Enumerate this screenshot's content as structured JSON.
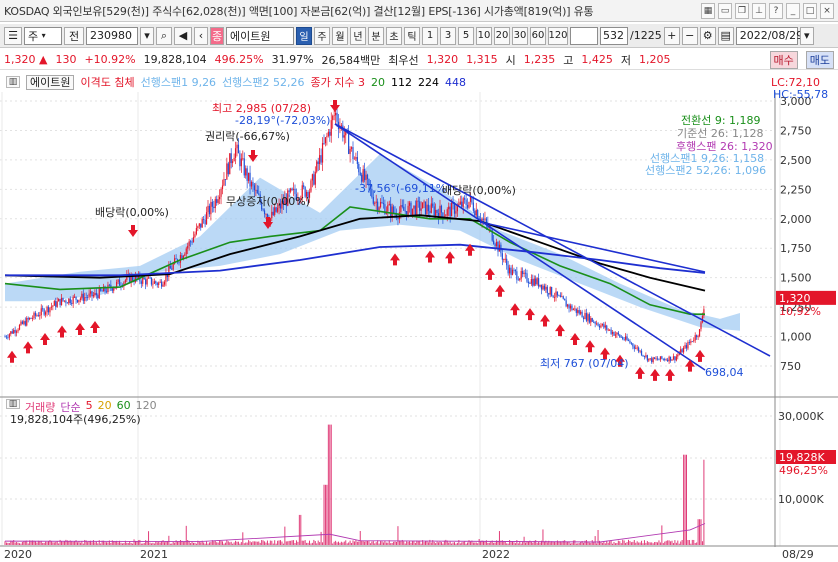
{
  "info": {
    "text": "KOSDAQ 외국인보유[529(천)] 주식수[62,028(천)] 액면[100] 자본금[62(억)] 결산[12월] EPS[-136] 시가총액[819(억)] 유통"
  },
  "toolbar": {
    "mode": "주",
    "type": "전",
    "code": "230980",
    "name": "에이트원",
    "periods": [
      "일",
      "주",
      "월",
      "년",
      "분",
      "초",
      "틱"
    ],
    "selected_period": "일",
    "nums": [
      "1",
      "3",
      "5",
      "10",
      "20",
      "30",
      "60",
      "120"
    ],
    "count": "532",
    "total": "/1225",
    "date": "2022/08/29"
  },
  "quote": {
    "price": "1,320",
    "change": "130",
    "change_pct": "+10.92%",
    "volume": "19,828,104",
    "vol_pct": "496.25%",
    "turnover": "31.97%",
    "amount": "26,584백만",
    "best_ask_label": "최우선",
    "best_ask": "1,320",
    "best_bid": "1,315",
    "open_label": "시",
    "open": "1,235",
    "high_label": "고",
    "high": "1,425",
    "low_label": "저",
    "low": "1,205",
    "sell_btn": "매수",
    "buy_btn": "매도"
  },
  "legend": {
    "name": "에이트원",
    "disparity": "이격도 침체",
    "span1": "선행스팬1 9,26",
    "span2": "선행스팬2 52,26",
    "ma_label": "종가 지수 3",
    "ma_values": [
      "20",
      "112",
      "224",
      "448"
    ]
  },
  "right_top": {
    "lc": "LC:72,10",
    "hc": "HC:-55,78"
  },
  "ichimoku": {
    "conv": "전환선 9: 1,189",
    "base": "기준선 26: 1,128",
    "lag": "후행스팬 26: 1,320",
    "span1": "선행스팬1 9,26: 1,158",
    "span2": "선행스팬2 52,26: 1,096"
  },
  "annotations": {
    "high": "최고 2,985 (07/28)",
    "angle": "-28,19°(-72,03%)",
    "rights": "권리락(-66,67%)",
    "dividend": "배당락(0,00%)",
    "free": "무상증자(0,00%)",
    "angle2": "-37,56°(-69,11%)",
    "div2": "배당락(0,00%)",
    "low": "최저 767 (07/04)",
    "trend": "698,04"
  },
  "axis": {
    "price_ticks": [
      "3,000",
      "2,750",
      "2,500",
      "2,250",
      "2,000",
      "1,750",
      "1,500",
      "1,250",
      "1,000",
      "750"
    ],
    "current_price": "1,320",
    "current_pct": "10,92%",
    "vol_ticks": [
      "30,000K",
      "20,000K",
      "10,000K"
    ],
    "current_vol": "19,828K",
    "current_vol_pct": "496,25%",
    "dates": [
      "2020",
      "2021",
      "2022",
      "08/29"
    ]
  },
  "volume_legend": {
    "label": "거래량",
    "ma": "단순",
    "ma_values": [
      "5",
      "20",
      "60",
      "120"
    ],
    "summary": "19,828,104주(496,25%)"
  },
  "colors": {
    "up": "#e3162a",
    "down": "#1e4fd8",
    "ma20": "#1a8f1a",
    "ma112": "#000000",
    "ma224": "#1e2fd0",
    "cloud": "#9ec9f2",
    "volume": "#e03c78"
  }
}
